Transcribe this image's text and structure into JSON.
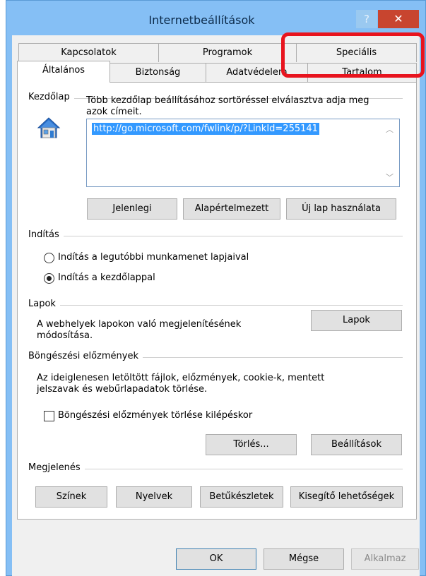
{
  "window": {
    "title": "Internetbeállítások",
    "help_label": "?",
    "close_label": "✕"
  },
  "tabs": {
    "row1": [
      "Kapcsolatok",
      "Programok",
      "Speciális"
    ],
    "row2": [
      "Általános",
      "Biztonság",
      "Adatvédelem",
      "Tartalom"
    ],
    "active": "Általános"
  },
  "homepage": {
    "group_label": "Kezdőlap",
    "description_line1": "Több kezdőlap beállításához sortöréssel elválasztva adja meg",
    "description_line2": "azok címeit.",
    "url": "http://go.microsoft.com/fwlink/p/?LinkId=255141",
    "icon": "house-icon",
    "buttons": {
      "current": "Jelenlegi",
      "default": "Alapértelmezett",
      "new_tab": "Új lap használata"
    }
  },
  "startup": {
    "group_label": "Indítás",
    "option_last_session": "Indítás a legutóbbi munkamenet lapjaival",
    "option_homepage": "Indítás a kezdőlappal",
    "selected": "option_homepage"
  },
  "tabs_section": {
    "group_label": "Lapok",
    "description_line1": "A webhelyek lapokon való megjelenítésének",
    "description_line2": "módosítása.",
    "button": "Lapok"
  },
  "history": {
    "group_label": "Böngészési előzmények",
    "description_line1": "Az ideiglenesen letöltött fájlok, előzmények, cookie-k, mentett",
    "description_line2": "jelszavak és webűrlapadatok törlése.",
    "checkbox_label": "Böngészési előzmények törlése kilépéskor",
    "checkbox_checked": false,
    "delete_button": "Törlés...",
    "settings_button": "Beállítások"
  },
  "appearance": {
    "group_label": "Megjelenés",
    "buttons": [
      "Színek",
      "Nyelvek",
      "Betűkészletek",
      "Kisegítő lehetőségek"
    ]
  },
  "footer": {
    "ok": "OK",
    "cancel": "Mégse",
    "apply": "Alkalmaz"
  },
  "colors": {
    "titlebar": "#85bff5",
    "close_button": "#c8452f",
    "highlight": "#e8141e",
    "selection": "#3399ff"
  }
}
